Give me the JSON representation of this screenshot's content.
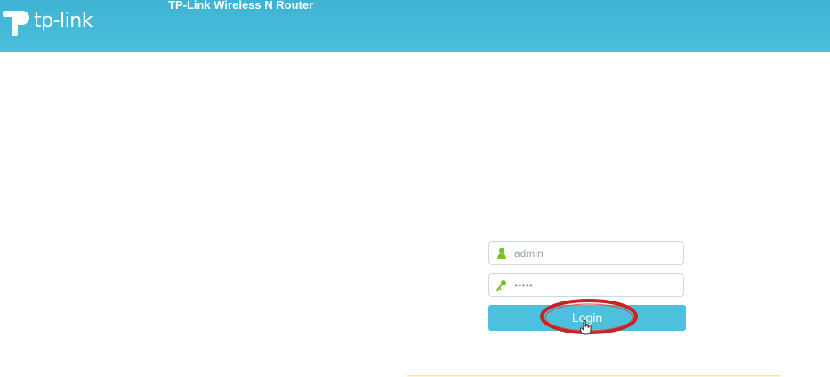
{
  "header": {
    "logo_text": "tp-link",
    "product_title": "TP-Link Wireless N Router"
  },
  "login": {
    "username": {
      "value": "admin",
      "icon": "user-icon"
    },
    "password": {
      "value": "•••••",
      "icon": "key-icon"
    },
    "button_label": "Login"
  },
  "colors": {
    "header": "#44bad8",
    "button": "#4cc0dc",
    "icon": "#7bbf2e",
    "highlight": "#c82222"
  }
}
